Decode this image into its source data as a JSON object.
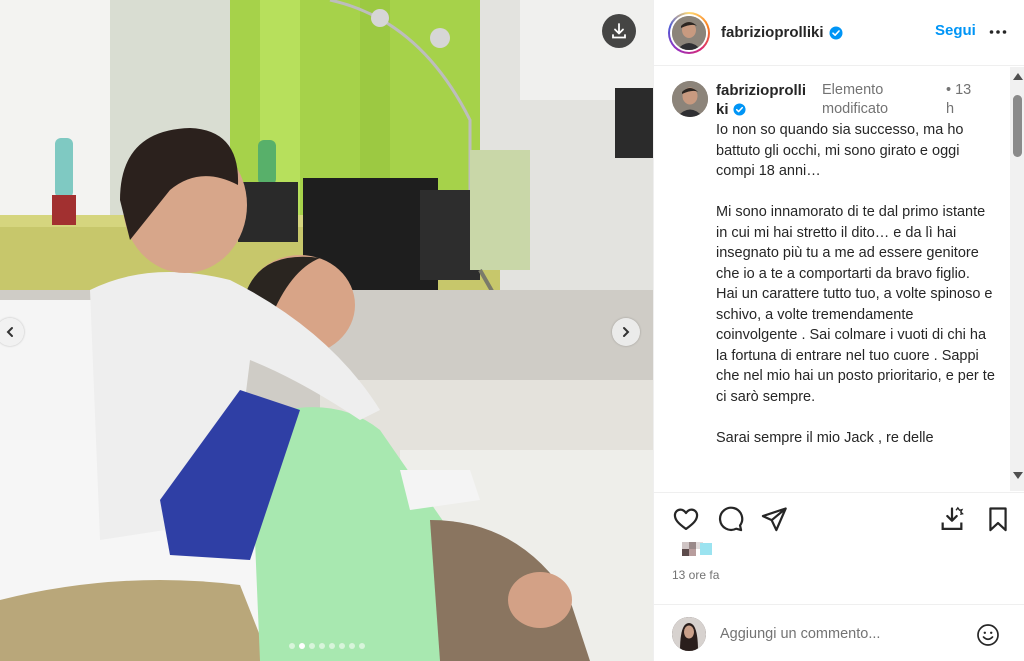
{
  "post": {
    "username": "fabrizioprolliki",
    "caption_username": "fabrizioprolliki",
    "edited_label": "Elemento modificato",
    "time_short": "13 h",
    "caption": "Io non so quando sia successo, ma ho battuto gli occhi, mi sono girato e oggi compi 18 anni…\n\nMi sono innamorato di te dal primo istante in cui mi hai stretto il dito… e da lì hai insegnato più tu a me ad essere genitore che io a te a comportarti da bravo figlio.\nHai un carattere tutto tuo, a volte spinoso e schivo, a volte tremendamente coinvolgente . Sai colmare i vuoti di chi ha la fortuna di entrare nel tuo cuore . Sappi che nel mio hai un posto prioritario, e per te ci sarò sempre.\n\nSarai sempre il mio Jack , re delle",
    "time_ago": "13 ore fa"
  },
  "header": {
    "follow_label": "Segui"
  },
  "media": {
    "slide_count": 8,
    "active_slide": 2
  },
  "comment_box": {
    "placeholder": "Aggiungi un commento..."
  },
  "colors": {
    "accent": "#0095f6",
    "verified": "#0095f6",
    "muted_text": "#737373"
  },
  "icons": [
    "download-icon",
    "chevron-left-icon",
    "chevron-right-icon",
    "verified-badge-icon",
    "more-icon",
    "heart-icon",
    "comment-icon",
    "share-icon",
    "save-collection-icon",
    "bookmark-icon",
    "emoji-icon"
  ]
}
